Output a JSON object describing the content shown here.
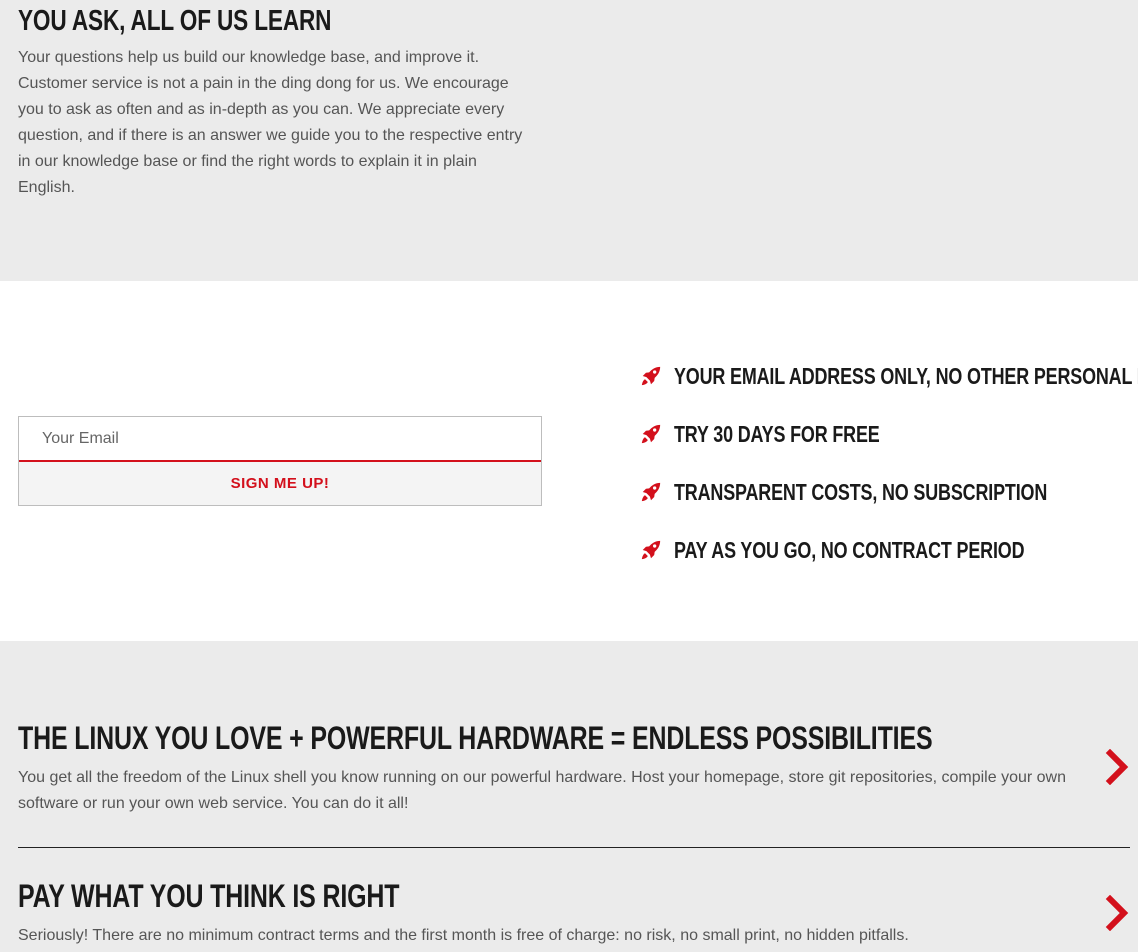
{
  "intro": {
    "title": "YOU ASK, ALL OF US LEARN",
    "body": "Your questions help us build our knowledge base, and improve it. Customer service is not a pain in the ding dong for us. We encourage you to ask as often and as in-depth as you can. We appreciate every question, and if there is an answer we guide you to the respective entry in our knowledge base or find the right words to explain it in plain English."
  },
  "signup": {
    "email_placeholder": "Your Email",
    "button_label": "SIGN ME UP!"
  },
  "features": [
    {
      "icon": "rocket-icon",
      "label": "YOUR EMAIL ADDRESS ONLY, NO OTHER PERSONAL DATA"
    },
    {
      "icon": "rocket-icon",
      "label": "TRY 30 DAYS FOR FREE"
    },
    {
      "icon": "rocket-icon",
      "label": "TRANSPARENT COSTS, NO SUBSCRIPTION"
    },
    {
      "icon": "rocket-icon",
      "label": "PAY AS YOU GO, NO CONTRACT PERIOD"
    }
  ],
  "accordion": [
    {
      "title": "THE LINUX YOU LOVE + POWERFUL HARDWARE = ENDLESS POSSIBILITIES",
      "body": "You get all the freedom of the Linux shell you know running on our powerful hardware. Host your homepage, store git repositories, compile your own software or run your own web service. You can do it all!"
    },
    {
      "title": "PAY WHAT YOU THINK IS RIGHT",
      "body": "Seriously! There are no minimum contract terms and the first month is free of charge: no risk, no small print, no hidden pitfalls."
    }
  ],
  "colors": {
    "accent": "#d3101c",
    "section_background": "#ebebeb",
    "text_dark": "#1a1a1a",
    "text_body": "#555555"
  }
}
